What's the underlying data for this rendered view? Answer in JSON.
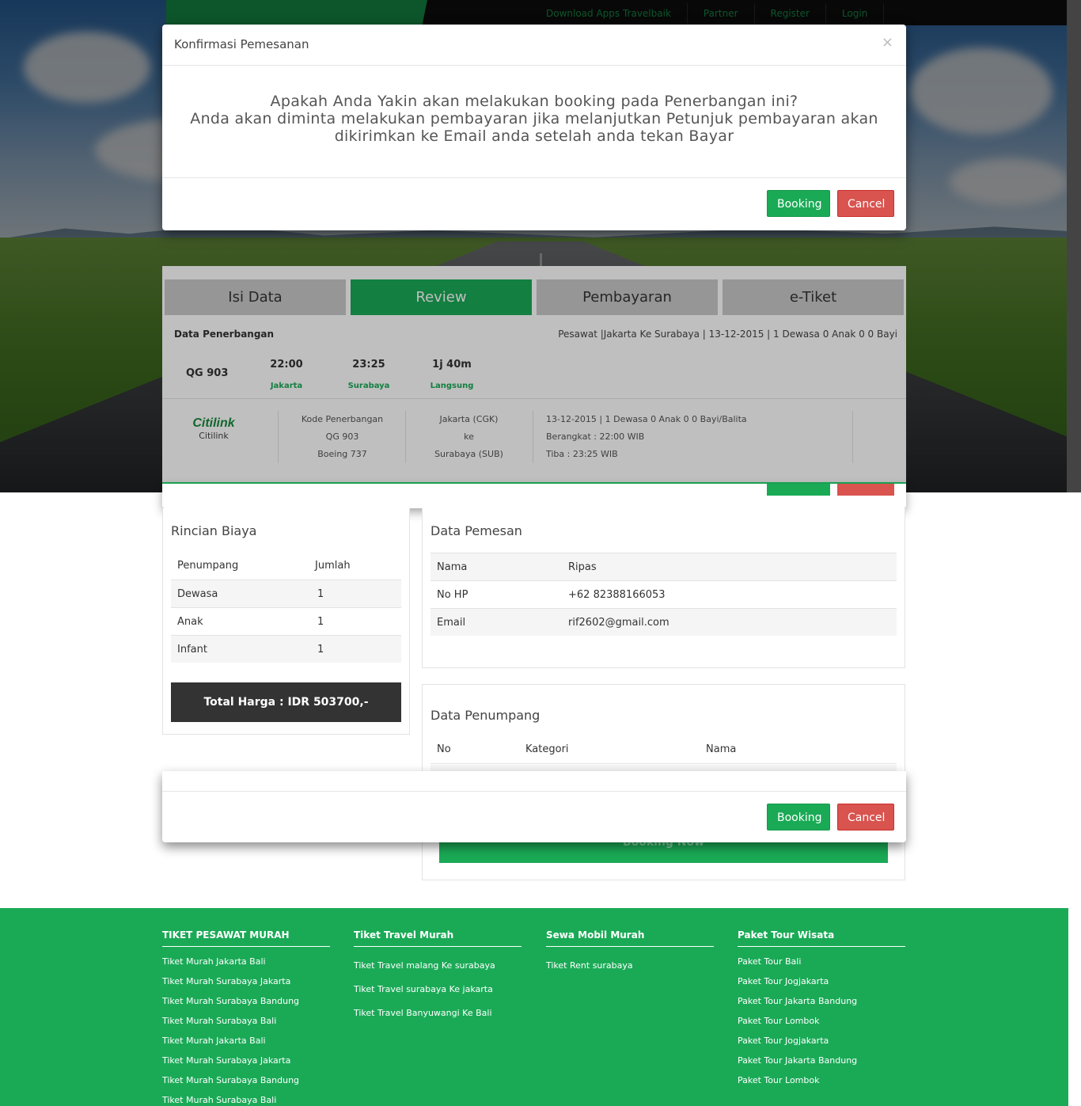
{
  "topnav": {
    "links": [
      "Download Apps Travelbaik",
      "Partner",
      "Register",
      "Login"
    ]
  },
  "modal": {
    "title": "Konfirmasi Pemesanan",
    "close": "×",
    "message_line1": "Apakah Anda Yakin akan melakukan booking pada Penerbangan ini?",
    "message_line2": "Anda akan diminta melakukan pembayaran jika melanjutkan Petunjuk pembayaran akan dikirimkan ke Email anda setelah anda tekan Bayar",
    "booking_label": "Booking",
    "cancel_label": "Cancel"
  },
  "steps": [
    "Isi Data",
    "Review",
    "Pembayaran",
    "e-Tiket"
  ],
  "flight": {
    "section_label": "Data Penerbangan",
    "summary": "Pesawat |Jakarta Ke Surabaya | 13-12-2015 | 1 Dewasa 0 Anak 0 0 Bayi",
    "code": "QG 903",
    "depart_time": "22:00",
    "depart_city": "Jakarta",
    "arrive_time": "23:25",
    "arrive_city": "Surabaya",
    "duration": "1j 40m",
    "route_type": "Langsung",
    "airline_logo": "Citilink",
    "airline_name": "Citilink",
    "kode_label": "Kode Penerbangan",
    "kode_value": "QG 903",
    "aircraft": "Boeing 737",
    "origin": "Jakarta (CGK)",
    "ke": "ke",
    "destination": "Surabaya (SUB)",
    "detail_line1": "13-12-2015 | 1 Dewasa 0 Anak 0 0 Bayi/Balita",
    "detail_line2": "Berangkat : 22:00 WIB",
    "detail_line3": "Tiba : 23:25 WIB"
  },
  "rincian": {
    "title": "Rincian Biaya",
    "col1": "Penumpang",
    "col2": "Jumlah",
    "rows": [
      {
        "label": "Dewasa",
        "value": "1"
      },
      {
        "label": "Anak",
        "value": "1"
      },
      {
        "label": "Infant",
        "value": "1"
      }
    ],
    "total": "Total Harga : IDR 503700,-"
  },
  "pemesan": {
    "title": "Data Pemesan",
    "rows": [
      {
        "label": "Nama",
        "value": "Ripas"
      },
      {
        "label": "No HP",
        "value": "+62 82388166053"
      },
      {
        "label": "Email",
        "value": "rif2602@gmail.com"
      }
    ]
  },
  "penumpang": {
    "title": "Data Penumpang",
    "col_no": "No",
    "col_kategori": "Kategori",
    "col_nama": "Nama"
  },
  "modal2": {
    "booking_label": "Booking",
    "cancel_label": "Cancel"
  },
  "booknow": "Booking Now",
  "footer": {
    "col1": {
      "title": "TIKET PESAWAT MURAH",
      "links": [
        "Tiket Murah Jakarta Bali",
        "Tiket Murah Surabaya Jakarta",
        "Tiket Murah Surabaya Bandung",
        "Tiket Murah Surabaya Bali",
        "Tiket Murah Jakarta Bali",
        "Tiket Murah Surabaya Jakarta",
        "Tiket Murah Surabaya Bandung",
        "Tiket Murah Surabaya Bali"
      ]
    },
    "col2": {
      "title": "Tiket Travel Murah",
      "links": [
        "Tiket Travel malang Ke surabaya",
        "Tiket Travel surabaya Ke jakarta",
        "Tiket Travel Banyuwangi Ke Bali"
      ]
    },
    "col3": {
      "title": "Sewa Mobil Murah",
      "links": [
        "Tiket Rent surabaya"
      ]
    },
    "col4": {
      "title": "Paket Tour Wisata",
      "links": [
        "Paket Tour Bali",
        "Paket Tour Jogjakarta",
        "Paket Tour Jakarta Bandung",
        "Paket Tour Lombok",
        "Paket Tour Jogjakarta",
        "Paket Tour Jakarta Bandung",
        "Paket Tour Lombok"
      ]
    }
  }
}
